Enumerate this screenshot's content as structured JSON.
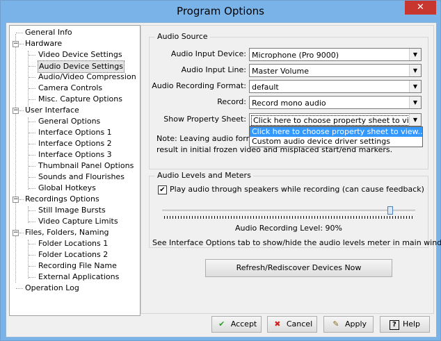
{
  "window": {
    "title": "Program Options",
    "close_glyph": "✕"
  },
  "tree": {
    "items": [
      {
        "label": "General Info"
      },
      {
        "label": "Hardware"
      },
      {
        "label": "Video Device Settings"
      },
      {
        "label": "Audio Device Settings"
      },
      {
        "label": "Audio/Video Compression"
      },
      {
        "label": "Camera Controls"
      },
      {
        "label": "Misc. Capture Options"
      },
      {
        "label": "User Interface"
      },
      {
        "label": "General Options"
      },
      {
        "label": "Interface Options 1"
      },
      {
        "label": "Interface Options 2"
      },
      {
        "label": "Interface Options 3"
      },
      {
        "label": "Thumbnail Panel Options"
      },
      {
        "label": "Sounds and Flourishes"
      },
      {
        "label": "Global Hotkeys"
      },
      {
        "label": "Recordings Options"
      },
      {
        "label": "Still Image Bursts"
      },
      {
        "label": "Video Capture Limits"
      },
      {
        "label": "Files, Folders, Naming"
      },
      {
        "label": "Folder Locations 1"
      },
      {
        "label": "Folder Locations 2"
      },
      {
        "label": "Recording File Name"
      },
      {
        "label": "External Applications"
      },
      {
        "label": "Operation Log"
      }
    ],
    "selected": "Audio Device Settings",
    "expander_glyph": "−"
  },
  "audio_source": {
    "legend": "Audio Source",
    "input_device": {
      "label": "Audio Input Device:",
      "value": "Microphone (Pro 9000)"
    },
    "input_line": {
      "label": "Audio Input Line:",
      "value": "Master Volume"
    },
    "recording_format": {
      "label": "Audio Recording Format:",
      "value": "default"
    },
    "record": {
      "label": "Record:",
      "value": "Record mono audio"
    },
    "property_sheet": {
      "label": "Show Property Sheet:",
      "value": "Click here to choose property sheet to view..",
      "options": [
        "Click here to choose property sheet to view..",
        "Custom audio device driver settings"
      ]
    },
    "note_line1": "Note: Leaving audio format",
    "note_line2": "result in initial frozen video and misplaced start/end markers."
  },
  "audio_levels": {
    "legend": "Audio Levels and Meters",
    "play_checkbox": {
      "label": "Play audio through speakers while recording (can cause feedback)",
      "checked": true,
      "glyph": "✔"
    },
    "level_label": "Audio Recording Level: 90%",
    "level_value": 0.9,
    "hint": "See Interface Options tab to show/hide the audio levels meter in main window."
  },
  "refresh_button": "Refresh/Rediscover Devices Now",
  "buttons": {
    "accept": {
      "label": "Accept",
      "icon": "✔",
      "color": "#2e9e2e"
    },
    "cancel": {
      "label": "Cancel",
      "icon": "✖",
      "color": "#d42020"
    },
    "apply": {
      "label": "Apply",
      "icon": "✎",
      "color": "#8a6d1a"
    },
    "help": {
      "label": "Help",
      "icon": "?",
      "color": "#000000"
    }
  },
  "dropdown_arrow": "▼"
}
